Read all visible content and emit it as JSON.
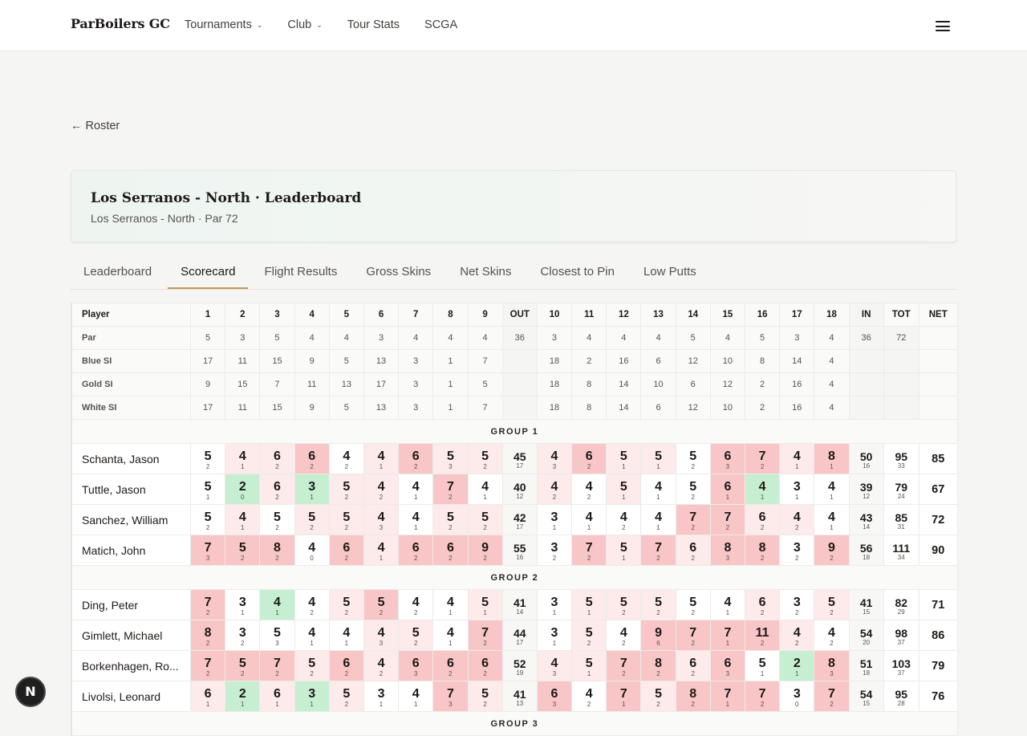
{
  "nav": {
    "brand": "ParBoilers GC",
    "items": [
      {
        "label": "Tournaments",
        "dropdown": true
      },
      {
        "label": "Club",
        "dropdown": true
      },
      {
        "label": "Tour Stats",
        "dropdown": false
      },
      {
        "label": "SCGA",
        "dropdown": false
      }
    ],
    "menu_icon": "hamburger-icon"
  },
  "back_link": "← Roster",
  "header": {
    "title": "Los Serranos - North · Leaderboard",
    "subtitle": "Los Serranos - North · Par 72"
  },
  "tabs": [
    {
      "label": "Leaderboard",
      "active": false
    },
    {
      "label": "Scorecard",
      "active": true
    },
    {
      "label": "Flight Results",
      "active": false
    },
    {
      "label": "Gross Skins",
      "active": false
    },
    {
      "label": "Net Skins",
      "active": false
    },
    {
      "label": "Closest to Pin",
      "active": false
    },
    {
      "label": "Low Putts",
      "active": false
    }
  ],
  "scorecard": {
    "columns": [
      "Player",
      "1",
      "2",
      "3",
      "4",
      "5",
      "6",
      "7",
      "8",
      "9",
      "OUT",
      "10",
      "11",
      "12",
      "13",
      "14",
      "15",
      "16",
      "17",
      "18",
      "IN",
      "TOT",
      "NET"
    ],
    "info_rows": [
      {
        "label": "Par",
        "values": [
          "5",
          "3",
          "5",
          "4",
          "4",
          "3",
          "4",
          "4",
          "4",
          "36",
          "3",
          "4",
          "4",
          "4",
          "5",
          "4",
          "5",
          "3",
          "4",
          "36",
          "72",
          ""
        ]
      },
      {
        "label": "Blue SI",
        "values": [
          "17",
          "11",
          "15",
          "9",
          "5",
          "13",
          "3",
          "1",
          "7",
          "",
          "18",
          "2",
          "16",
          "6",
          "12",
          "10",
          "8",
          "14",
          "4",
          "",
          "",
          ""
        ]
      },
      {
        "label": "Gold SI",
        "values": [
          "9",
          "15",
          "7",
          "11",
          "13",
          "17",
          "3",
          "1",
          "5",
          "",
          "18",
          "8",
          "14",
          "10",
          "6",
          "12",
          "2",
          "16",
          "4",
          "",
          "",
          ""
        ]
      },
      {
        "label": "White SI",
        "values": [
          "17",
          "11",
          "15",
          "9",
          "5",
          "13",
          "3",
          "1",
          "7",
          "",
          "18",
          "8",
          "14",
          "6",
          "12",
          "10",
          "2",
          "16",
          "4",
          "",
          "",
          ""
        ]
      }
    ],
    "groups": [
      {
        "label": "GROUP 1",
        "players": [
          {
            "name": "Schanta, Jason",
            "holes": [
              [
                "5",
                "2"
              ],
              [
                "4",
                "1"
              ],
              [
                "6",
                "2"
              ],
              [
                "6",
                "2"
              ],
              [
                "4",
                "2"
              ],
              [
                "4",
                "1"
              ],
              [
                "6",
                "2"
              ],
              [
                "5",
                "3"
              ],
              [
                "5",
                "2"
              ],
              [
                "4",
                "3"
              ],
              [
                "6",
                "2"
              ],
              [
                "5",
                "1"
              ],
              [
                "5",
                "1"
              ],
              [
                "5",
                "2"
              ],
              [
                "6",
                "3"
              ],
              [
                "7",
                "2"
              ],
              [
                "4",
                "1"
              ],
              [
                "8",
                "1"
              ]
            ],
            "out": [
              "45",
              "17"
            ],
            "in": [
              "50",
              "16"
            ],
            "tot": [
              "95",
              "33"
            ],
            "net": "85"
          },
          {
            "name": "Tuttle, Jason",
            "holes": [
              [
                "5",
                "1"
              ],
              [
                "2",
                "0"
              ],
              [
                "6",
                "2"
              ],
              [
                "3",
                "1"
              ],
              [
                "5",
                "2"
              ],
              [
                "4",
                "2"
              ],
              [
                "4",
                "1"
              ],
              [
                "7",
                "2"
              ],
              [
                "4",
                "1"
              ],
              [
                "4",
                "2"
              ],
              [
                "4",
                "2"
              ],
              [
                "5",
                "1"
              ],
              [
                "4",
                "1"
              ],
              [
                "5",
                "2"
              ],
              [
                "6",
                "1"
              ],
              [
                "4",
                "1"
              ],
              [
                "3",
                "1"
              ],
              [
                "4",
                "1"
              ]
            ],
            "out": [
              "40",
              "12"
            ],
            "in": [
              "39",
              "12"
            ],
            "tot": [
              "79",
              "24"
            ],
            "net": "67"
          },
          {
            "name": "Sanchez, William",
            "holes": [
              [
                "5",
                "2"
              ],
              [
                "4",
                "1"
              ],
              [
                "5",
                "2"
              ],
              [
                "5",
                "2"
              ],
              [
                "5",
                "2"
              ],
              [
                "4",
                "3"
              ],
              [
                "4",
                "1"
              ],
              [
                "5",
                "2"
              ],
              [
                "5",
                "2"
              ],
              [
                "3",
                "1"
              ],
              [
                "4",
                "1"
              ],
              [
                "4",
                "2"
              ],
              [
                "4",
                "1"
              ],
              [
                "7",
                "2"
              ],
              [
                "7",
                "2"
              ],
              [
                "6",
                "2"
              ],
              [
                "4",
                "2"
              ],
              [
                "4",
                "1"
              ]
            ],
            "out": [
              "42",
              "17"
            ],
            "in": [
              "43",
              "14"
            ],
            "tot": [
              "85",
              "31"
            ],
            "net": "72"
          },
          {
            "name": "Matich, John",
            "holes": [
              [
                "7",
                "3"
              ],
              [
                "5",
                "2"
              ],
              [
                "8",
                "2"
              ],
              [
                "4",
                "0"
              ],
              [
                "6",
                "2"
              ],
              [
                "4",
                "1"
              ],
              [
                "6",
                "2"
              ],
              [
                "6",
                "2"
              ],
              [
                "9",
                "2"
              ],
              [
                "3",
                "2"
              ],
              [
                "7",
                "2"
              ],
              [
                "5",
                "1"
              ],
              [
                "7",
                "2"
              ],
              [
                "6",
                "2"
              ],
              [
                "8",
                "3"
              ],
              [
                "8",
                "2"
              ],
              [
                "3",
                "2"
              ],
              [
                "9",
                "2"
              ]
            ],
            "out": [
              "55",
              "16"
            ],
            "in": [
              "56",
              "18"
            ],
            "tot": [
              "111",
              "34"
            ],
            "net": "90"
          }
        ]
      },
      {
        "label": "GROUP 2",
        "players": [
          {
            "name": "Ding, Peter",
            "holes": [
              [
                "7",
                "2"
              ],
              [
                "3",
                "1"
              ],
              [
                "4",
                "1"
              ],
              [
                "4",
                "2"
              ],
              [
                "5",
                "2"
              ],
              [
                "5",
                "2"
              ],
              [
                "4",
                "2"
              ],
              [
                "4",
                "1"
              ],
              [
                "5",
                "1"
              ],
              [
                "3",
                "1"
              ],
              [
                "5",
                "1"
              ],
              [
                "5",
                "2"
              ],
              [
                "5",
                "2"
              ],
              [
                "5",
                "2"
              ],
              [
                "4",
                "1"
              ],
              [
                "6",
                "2"
              ],
              [
                "3",
                "2"
              ],
              [
                "5",
                "2"
              ]
            ],
            "out": [
              "41",
              "14"
            ],
            "in": [
              "41",
              "15"
            ],
            "tot": [
              "82",
              "29"
            ],
            "net": "71"
          },
          {
            "name": "Gimlett, Michael",
            "holes": [
              [
                "8",
                "2"
              ],
              [
                "3",
                "2"
              ],
              [
                "5",
                "3"
              ],
              [
                "4",
                "1"
              ],
              [
                "4",
                "1"
              ],
              [
                "4",
                "3"
              ],
              [
                "5",
                "2"
              ],
              [
                "4",
                "1"
              ],
              [
                "7",
                "2"
              ],
              [
                "3",
                "1"
              ],
              [
                "5",
                "2"
              ],
              [
                "4",
                "2"
              ],
              [
                "9",
                "6"
              ],
              [
                "7",
                "2"
              ],
              [
                "7",
                "1"
              ],
              [
                "11",
                "2"
              ],
              [
                "4",
                "2"
              ],
              [
                "4",
                "2"
              ]
            ],
            "out": [
              "44",
              "17"
            ],
            "in": [
              "54",
              "20"
            ],
            "tot": [
              "98",
              "37"
            ],
            "net": "86"
          },
          {
            "name": "Borkenhagen, Ro...",
            "holes": [
              [
                "7",
                "2"
              ],
              [
                "5",
                "2"
              ],
              [
                "7",
                "2"
              ],
              [
                "5",
                "2"
              ],
              [
                "6",
                "2"
              ],
              [
                "4",
                "2"
              ],
              [
                "6",
                "3"
              ],
              [
                "6",
                "2"
              ],
              [
                "6",
                "2"
              ],
              [
                "4",
                "3"
              ],
              [
                "5",
                "1"
              ],
              [
                "7",
                "2"
              ],
              [
                "8",
                "2"
              ],
              [
                "6",
                "2"
              ],
              [
                "6",
                "3"
              ],
              [
                "5",
                "1"
              ],
              [
                "2",
                "1"
              ],
              [
                "8",
                "3"
              ]
            ],
            "out": [
              "52",
              "19"
            ],
            "in": [
              "51",
              "18"
            ],
            "tot": [
              "103",
              "37"
            ],
            "net": "79"
          },
          {
            "name": "Livolsi, Leonard",
            "holes": [
              [
                "6",
                "1"
              ],
              [
                "2",
                "1"
              ],
              [
                "6",
                "1"
              ],
              [
                "3",
                "1"
              ],
              [
                "5",
                "2"
              ],
              [
                "3",
                "1"
              ],
              [
                "4",
                "1"
              ],
              [
                "7",
                "3"
              ],
              [
                "5",
                "2"
              ],
              [
                "6",
                "3"
              ],
              [
                "4",
                "2"
              ],
              [
                "7",
                "1"
              ],
              [
                "5",
                "2"
              ],
              [
                "8",
                "2"
              ],
              [
                "7",
                "1"
              ],
              [
                "7",
                "2"
              ],
              [
                "3",
                "0"
              ],
              [
                "7",
                "2"
              ]
            ],
            "out": [
              "41",
              "13"
            ],
            "in": [
              "54",
              "15"
            ],
            "tot": [
              "95",
              "28"
            ],
            "net": "76"
          }
        ]
      },
      {
        "label": "GROUP 3",
        "players": []
      }
    ],
    "colors": {
      "bogey": "#fdeaea",
      "double_bogey": "#f8c6c6",
      "birdie": "#c6efd2",
      "accent": "#c79a56"
    }
  },
  "badge": "N"
}
